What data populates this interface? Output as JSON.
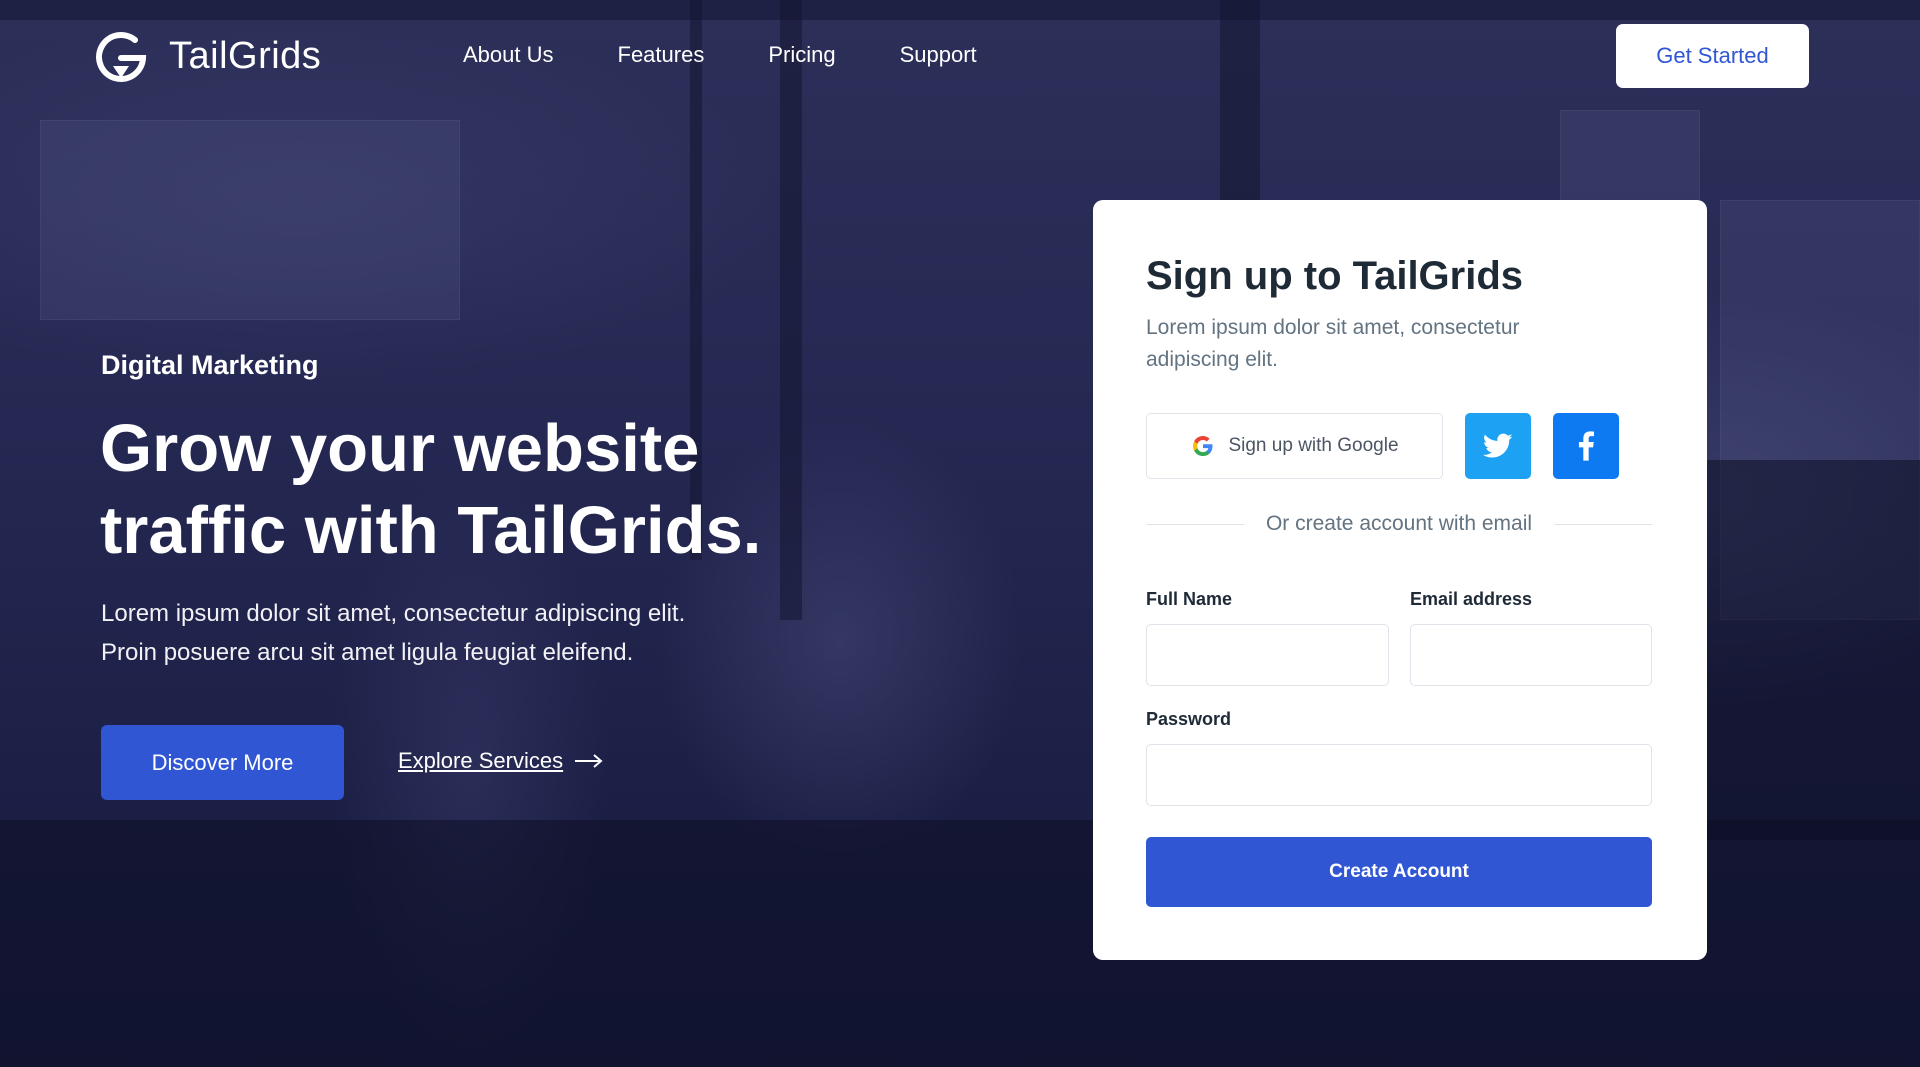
{
  "header": {
    "brand": "TailGrids",
    "nav": [
      {
        "label": "About Us"
      },
      {
        "label": "Features"
      },
      {
        "label": "Pricing"
      },
      {
        "label": "Support"
      }
    ],
    "cta_label": "Get Started"
  },
  "hero": {
    "tag": "Digital Marketing",
    "title_line1": "Grow your website",
    "title_line2": "traffic with TailGrids.",
    "description_line1": "Lorem ipsum dolor sit amet, consectetur adipiscing elit.",
    "description_line2": "Proin posuere arcu sit amet ligula feugiat eleifend.",
    "primary_button": "Discover More",
    "secondary_link": "Explore Services"
  },
  "signup": {
    "title": "Sign up to TailGrids",
    "subtitle_line1": "Lorem ipsum dolor sit amet, consectetur",
    "subtitle_line2": "adipiscing elit.",
    "google_button": "Sign up with Google",
    "divider_text": "Or create account with email",
    "full_name_label": "Full Name",
    "full_name_value": "",
    "email_label": "Email address",
    "email_value": "",
    "password_label": "Password",
    "password_value": "",
    "submit_label": "Create Account"
  },
  "icons": {
    "logo": "tailgrids-logo-icon",
    "google": "google-icon",
    "twitter": "twitter-icon",
    "facebook": "facebook-icon",
    "arrow": "arrow-right-icon"
  },
  "colors": {
    "primary": "#3056d3",
    "background_overlay": "#1e2147",
    "twitter": "#1da1f2",
    "facebook": "#0e7af2",
    "card": "#ffffff"
  }
}
